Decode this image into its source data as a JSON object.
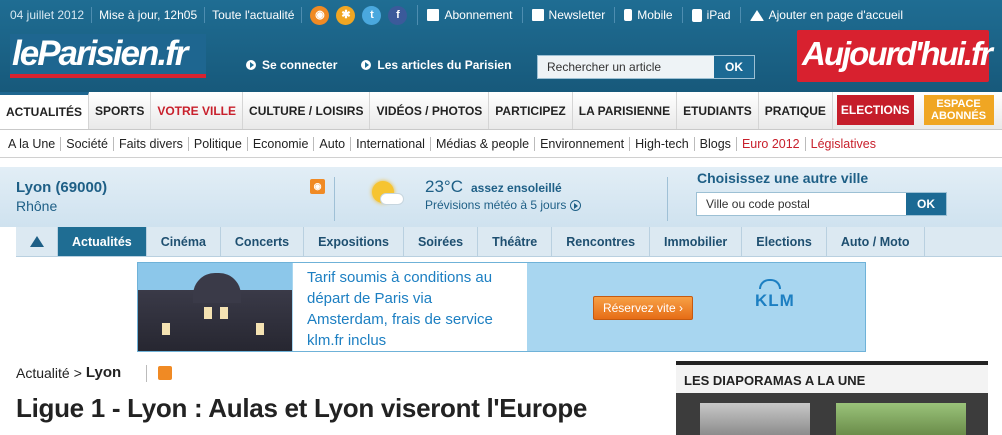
{
  "topbar": {
    "date": "04 juillet 2012",
    "updated": "Mise à jour, 12h05",
    "all_news": "Toute l'actualité",
    "links": [
      {
        "label": "Abonnement",
        "icon": "newspaper-icon"
      },
      {
        "label": "Newsletter",
        "icon": "envelope-icon"
      },
      {
        "label": "Mobile",
        "icon": "phone-icon"
      },
      {
        "label": "iPad",
        "icon": "tablet-icon"
      },
      {
        "label": "Ajouter en page d'accueil",
        "icon": "home-icon"
      }
    ]
  },
  "header": {
    "logo_left": "leParisien.fr",
    "logo_right": "Aujourd'hui.fr",
    "login": "Se connecter",
    "articles": "Les articles du Parisien",
    "search_placeholder": "Rechercher un article",
    "search_button": "OK"
  },
  "main_nav": {
    "items": [
      "ACTUALITÉS",
      "SPORTS",
      "VOTRE VILLE",
      "CULTURE / LOISIRS",
      "VIDÉOS / PHOTOS",
      "PARTICIPEZ",
      "LA PARISIENNE",
      "ETUDIANTS",
      "PRATIQUE"
    ],
    "elections": "ELECTIONS",
    "abonnes_line1": "ESPACE",
    "abonnes_line2": "ABONNÉS"
  },
  "sub_nav": {
    "items": [
      "A la Une",
      "Société",
      "Faits divers",
      "Politique",
      "Economie",
      "Auto",
      "International",
      "Médias & people",
      "Environnement",
      "High-tech",
      "Blogs",
      "Euro 2012",
      "Législatives"
    ]
  },
  "city": {
    "name": "Lyon (69000)",
    "region": "Rhône",
    "temperature": "23°C",
    "weather": "assez ensoleillé",
    "forecast": "Prévisions météo à 5 jours",
    "other_city_title": "Choisissez une autre ville",
    "city_placeholder": "Ville ou code postal",
    "city_button": "OK"
  },
  "city_tabs": {
    "items": [
      "Actualités",
      "Cinéma",
      "Concerts",
      "Expositions",
      "Soirées",
      "Théâtre",
      "Rencontres",
      "Immobilier",
      "Elections",
      "Auto / Moto"
    ]
  },
  "ad": {
    "lines": [
      "Tarif soumis à conditions au",
      "départ de Paris via",
      "Amsterdam, frais de service",
      "klm.fr inclus"
    ],
    "cta": "Réservez vite",
    "brand": "KLM"
  },
  "content": {
    "breadcrumb_root": "Actualité",
    "breadcrumb_sep": ">",
    "breadcrumb_current": "Lyon",
    "headline": "Ligue 1 - Lyon : Aulas et Lyon viseront l'Europe",
    "sidebar_title": "LES DIAPORAMAS A LA UNE"
  }
}
